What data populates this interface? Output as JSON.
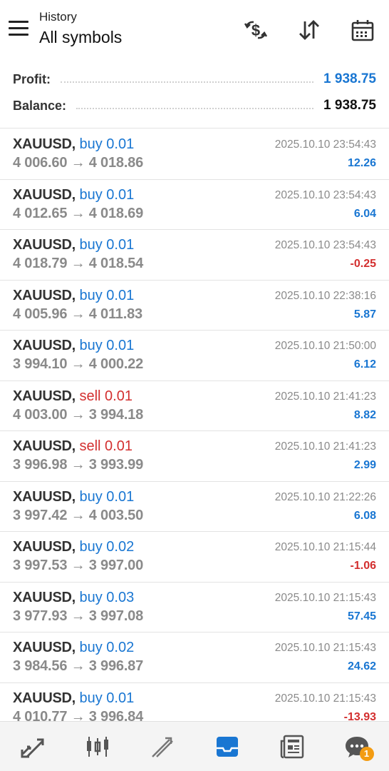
{
  "header": {
    "subtitle": "History",
    "title": "All symbols",
    "icons": [
      "menu-icon",
      "currency-exchange-icon",
      "sort-icon",
      "calendar-icon"
    ]
  },
  "summary": {
    "profit_label": "Profit:",
    "profit_value": "1 938.75",
    "balance_label": "Balance:",
    "balance_value": "1 938.75"
  },
  "colors": {
    "accent_blue": "#1976d2",
    "loss_red": "#d32f2f",
    "badge_orange": "#f39c12"
  },
  "deals": [
    {
      "symbol": "XAUUSD,",
      "side": "buy",
      "volume": "buy 0.01",
      "prices": "4 006.60 → 4 018.86",
      "time": "2025.10.10 23:54:43",
      "profit": "12.26"
    },
    {
      "symbol": "XAUUSD,",
      "side": "buy",
      "volume": "buy 0.01",
      "prices": "4 012.65 → 4 018.69",
      "time": "2025.10.10 23:54:43",
      "profit": "6.04"
    },
    {
      "symbol": "XAUUSD,",
      "side": "buy",
      "volume": "buy 0.01",
      "prices": "4 018.79 → 4 018.54",
      "time": "2025.10.10 23:54:43",
      "profit": "-0.25"
    },
    {
      "symbol": "XAUUSD,",
      "side": "buy",
      "volume": "buy 0.01",
      "prices": "4 005.96 → 4 011.83",
      "time": "2025.10.10 22:38:16",
      "profit": "5.87"
    },
    {
      "symbol": "XAUUSD,",
      "side": "buy",
      "volume": "buy 0.01",
      "prices": "3 994.10 → 4 000.22",
      "time": "2025.10.10 21:50:00",
      "profit": "6.12"
    },
    {
      "symbol": "XAUUSD,",
      "side": "sell",
      "volume": "sell 0.01",
      "prices": "4 003.00 → 3 994.18",
      "time": "2025.10.10 21:41:23",
      "profit": "8.82"
    },
    {
      "symbol": "XAUUSD,",
      "side": "sell",
      "volume": "sell 0.01",
      "prices": "3 996.98 → 3 993.99",
      "time": "2025.10.10 21:41:23",
      "profit": "2.99"
    },
    {
      "symbol": "XAUUSD,",
      "side": "buy",
      "volume": "buy 0.01",
      "prices": "3 997.42 → 4 003.50",
      "time": "2025.10.10 21:22:26",
      "profit": "6.08"
    },
    {
      "symbol": "XAUUSD,",
      "side": "buy",
      "volume": "buy 0.02",
      "prices": "3 997.53 → 3 997.00",
      "time": "2025.10.10 21:15:44",
      "profit": "-1.06"
    },
    {
      "symbol": "XAUUSD,",
      "side": "buy",
      "volume": "buy 0.03",
      "prices": "3 977.93 → 3 997.08",
      "time": "2025.10.10 21:15:43",
      "profit": "57.45"
    },
    {
      "symbol": "XAUUSD,",
      "side": "buy",
      "volume": "buy 0.02",
      "prices": "3 984.56 → 3 996.87",
      "time": "2025.10.10 21:15:43",
      "profit": "24.62"
    },
    {
      "symbol": "XAUUSD,",
      "side": "buy",
      "volume": "buy 0.01",
      "prices": "4 010.77 → 3 996.84",
      "time": "2025.10.10 21:15:43",
      "profit": "-13.93"
    }
  ],
  "bottom_nav": {
    "items": [
      {
        "icon": "quotes-icon",
        "active": false
      },
      {
        "icon": "chart-icon",
        "active": false
      },
      {
        "icon": "trade-icon",
        "active": false
      },
      {
        "icon": "history-icon",
        "active": true
      },
      {
        "icon": "news-icon",
        "active": false
      },
      {
        "icon": "messages-icon",
        "active": false
      }
    ],
    "messages_badge": "1"
  }
}
